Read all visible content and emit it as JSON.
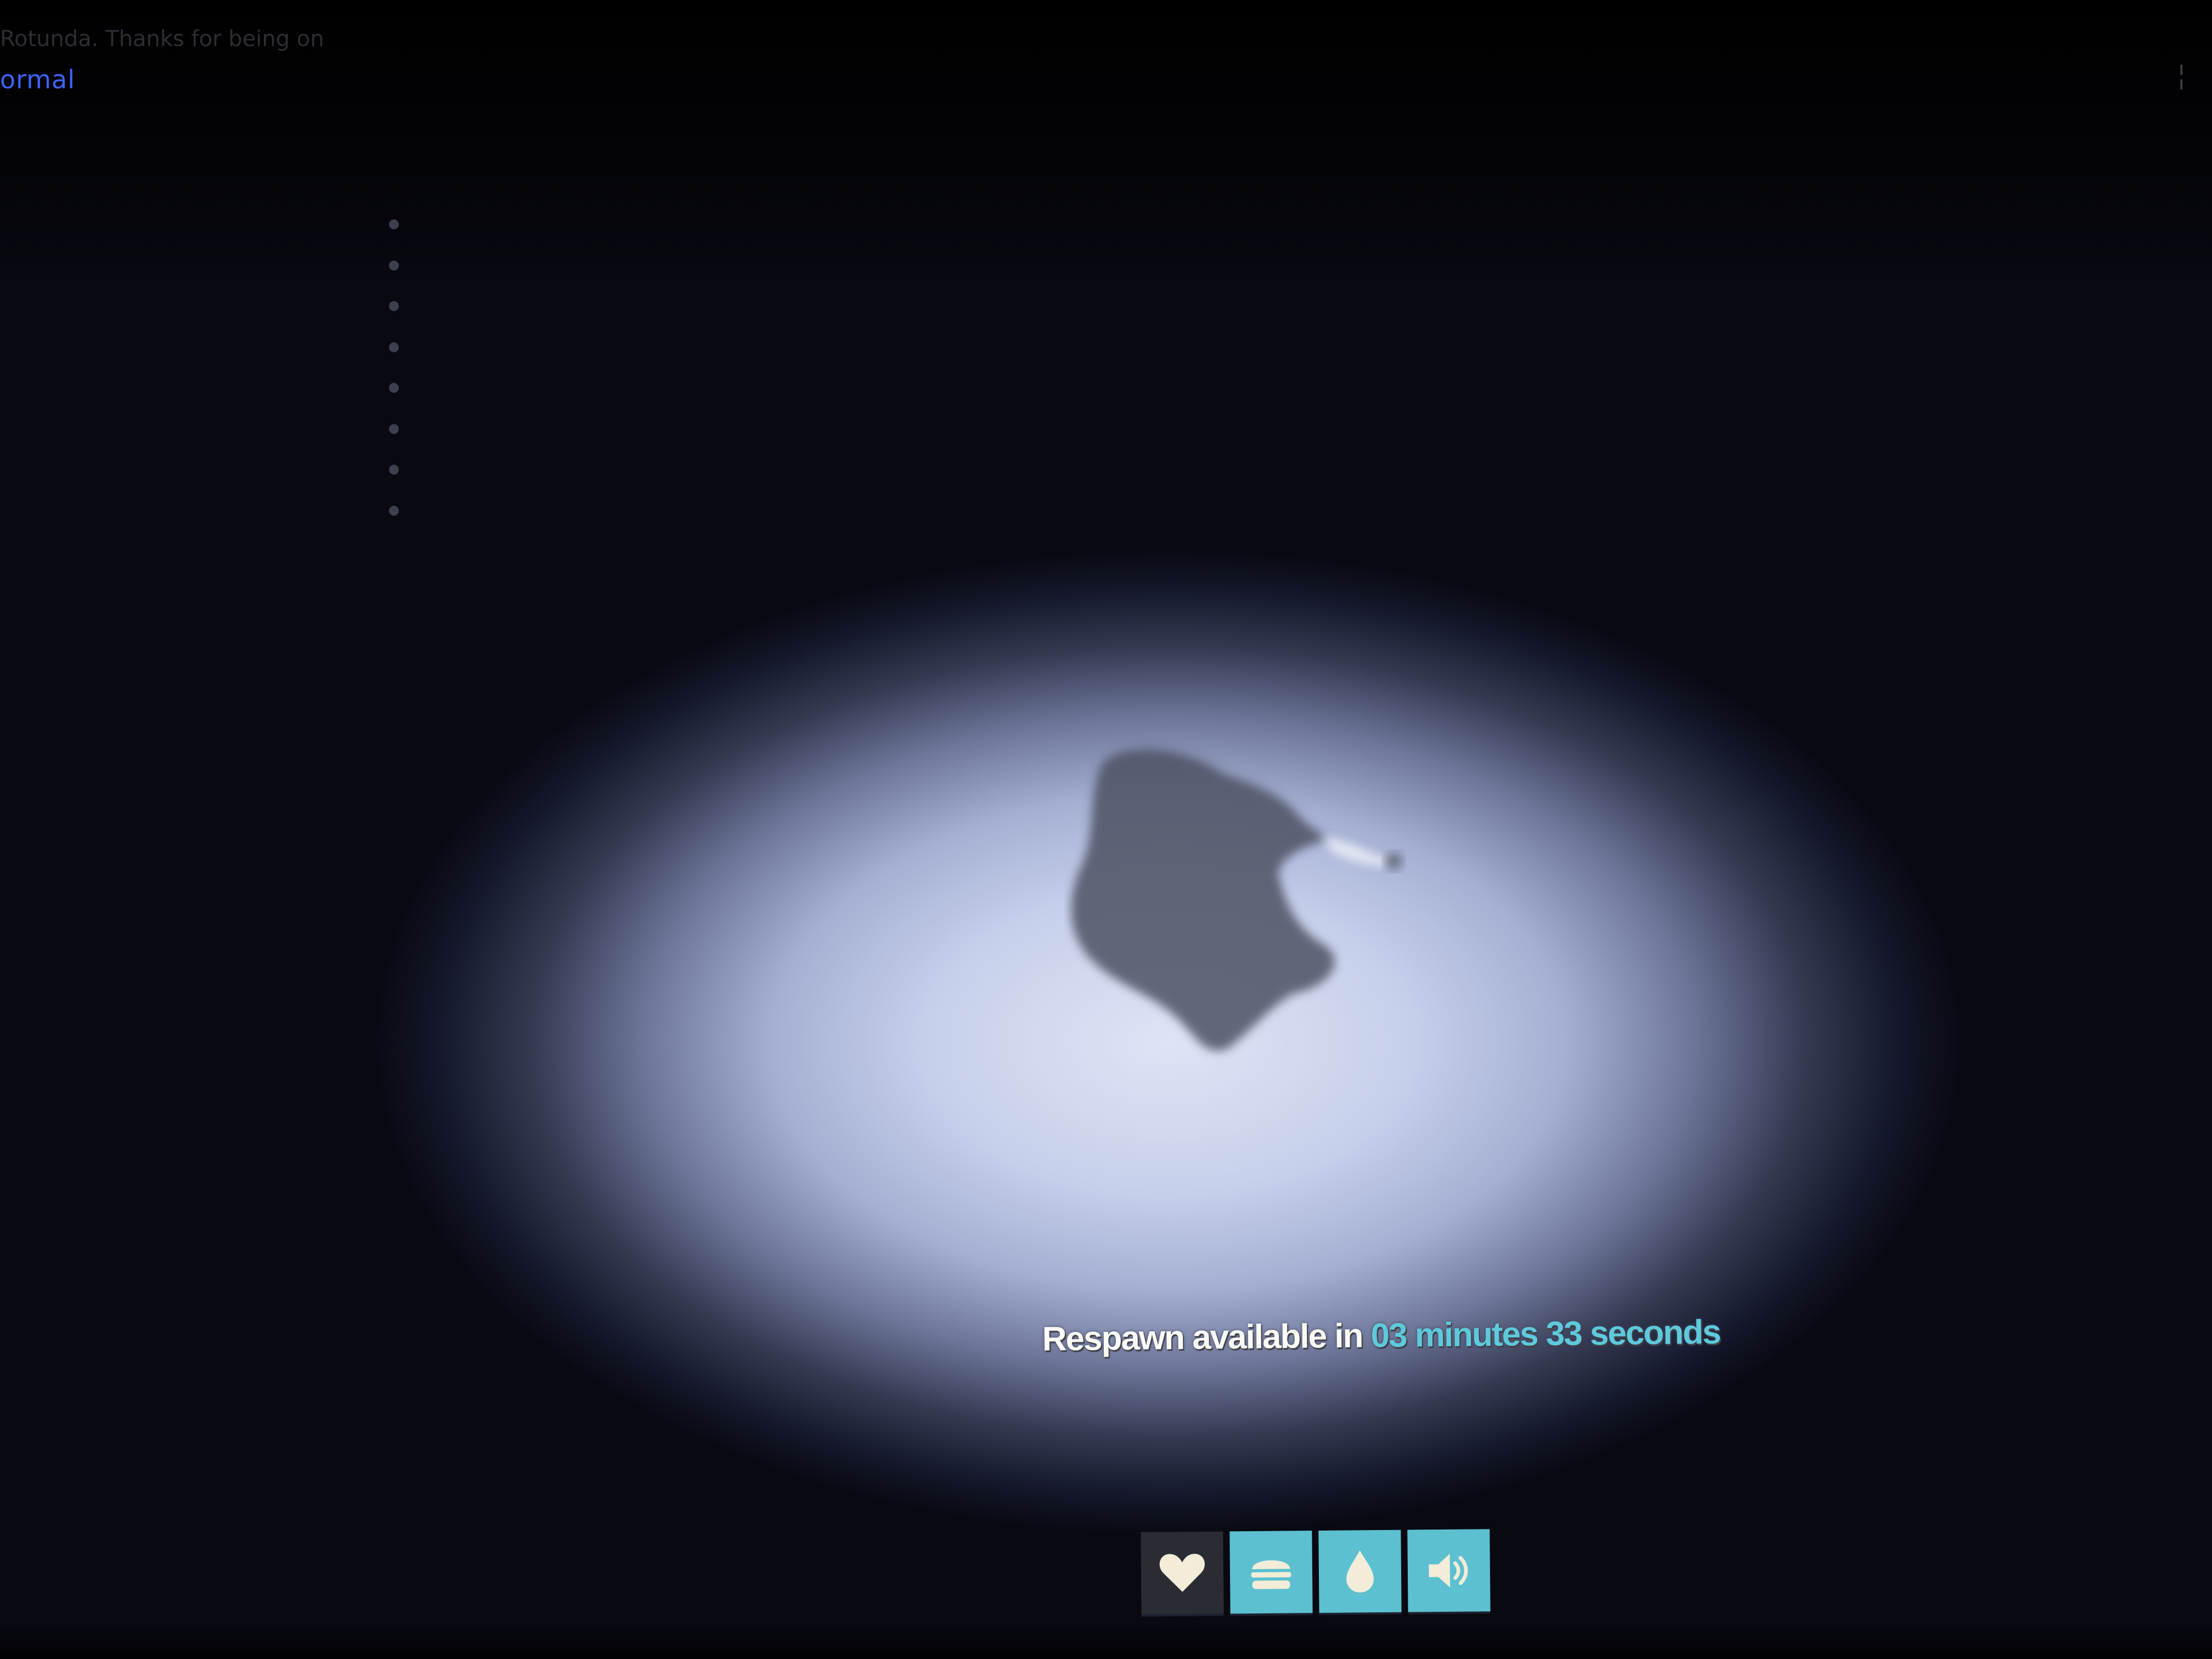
{
  "chat": {
    "line": "Rotunda. Thanks for being on"
  },
  "mode_label": "ormal",
  "corner_glyph": "¦",
  "respawn": {
    "prefix": "Respawn available in ",
    "minutes_value": "03",
    "minutes_unit": " minutes ",
    "seconds_value": "33",
    "seconds_unit": " seconds"
  },
  "status_icons": [
    {
      "name": "health",
      "icon": "heart-icon",
      "bg": "#2a2c34"
    },
    {
      "name": "hunger",
      "icon": "burger-icon",
      "bg": "#5cc0d0"
    },
    {
      "name": "thirst",
      "icon": "droplet-icon",
      "bg": "#5cc0d0"
    },
    {
      "name": "noise",
      "icon": "speaker-icon",
      "bg": "#5cc0d0"
    }
  ],
  "colors": {
    "timer_accent": "#5ec9dc",
    "mode_label": "#3d63ff",
    "icon_fill": "#f2ecd8"
  }
}
